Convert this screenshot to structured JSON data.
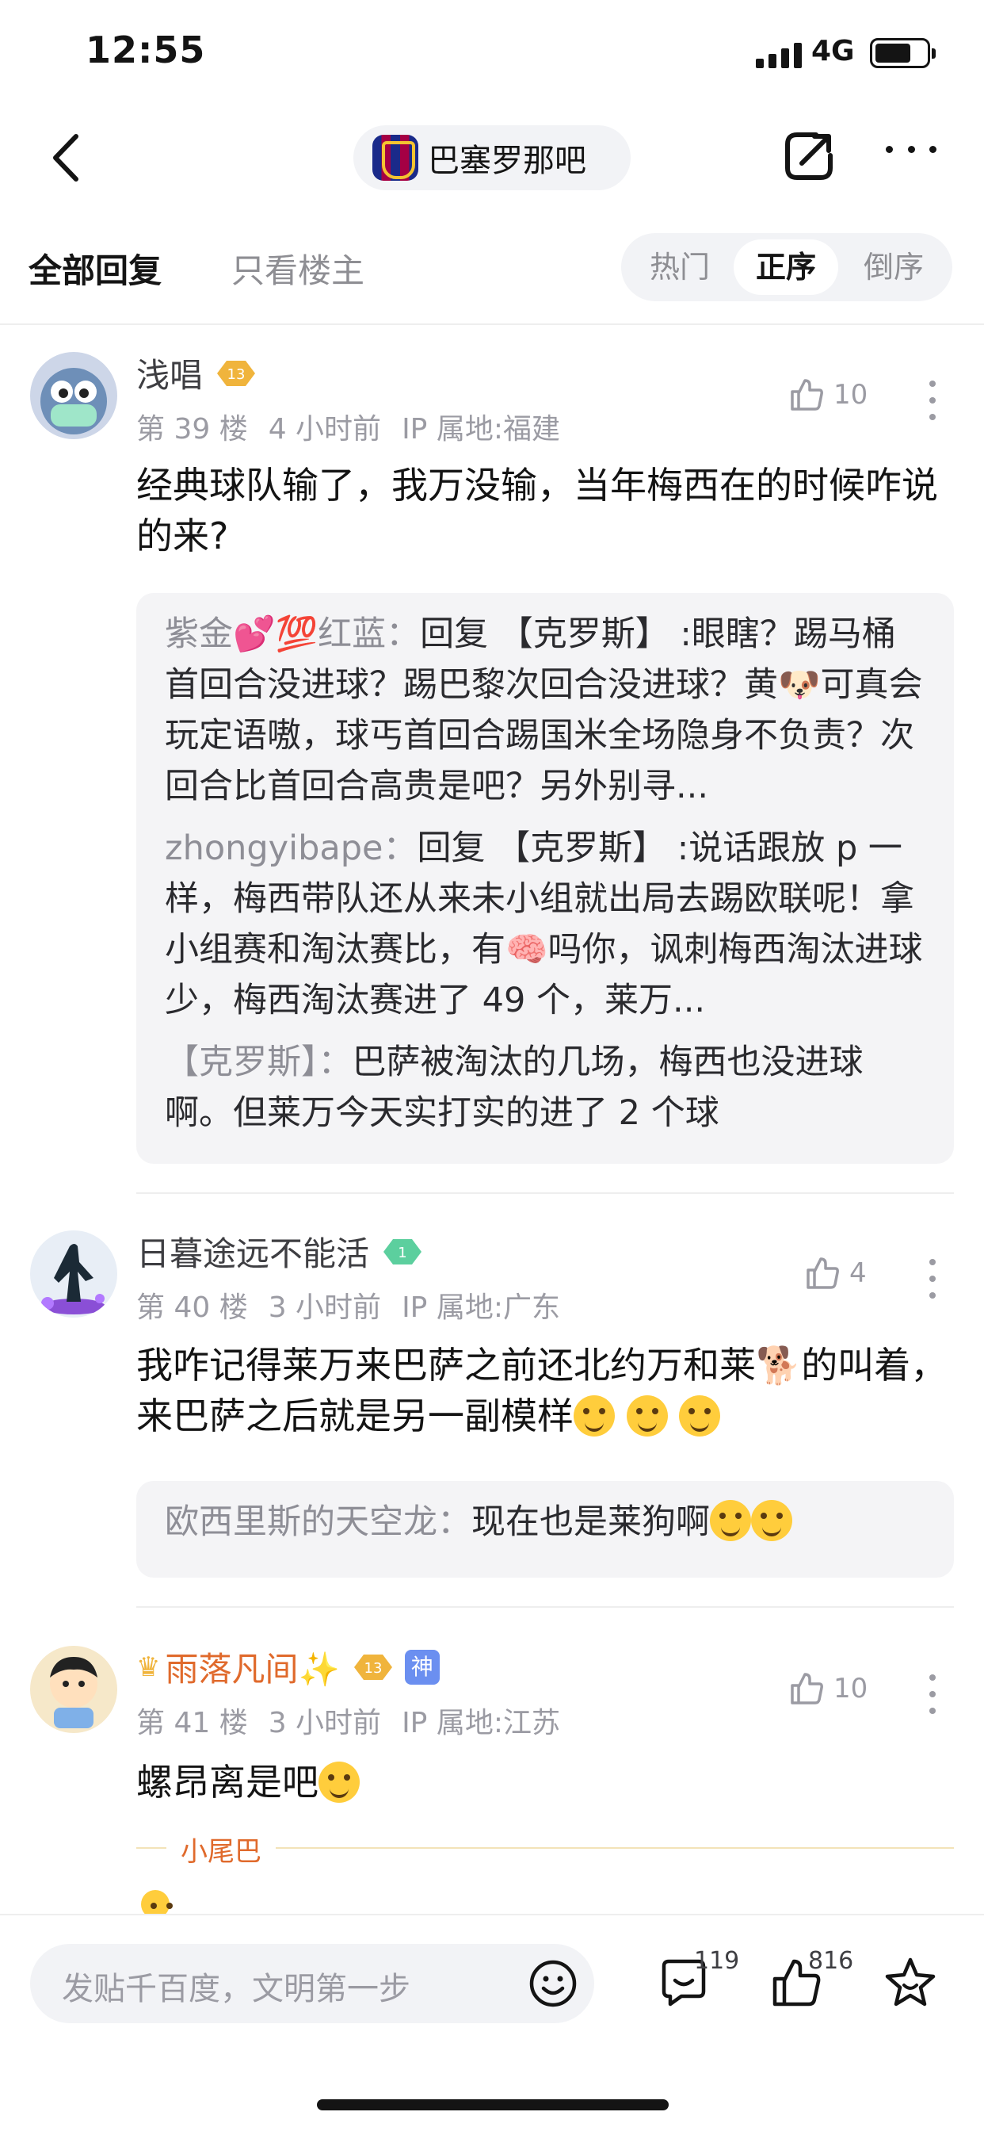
{
  "status_bar": {
    "time": "12:55",
    "network": "4G"
  },
  "nav": {
    "forum_name": "巴塞罗那吧"
  },
  "tabs": {
    "all": "全部回复",
    "op_only": "只看楼主"
  },
  "sort": {
    "hot": "热门",
    "asc": "正序",
    "desc": "倒序",
    "active": "正序"
  },
  "posts": [
    {
      "username": "浅唱",
      "level": "13",
      "floor": "第 39 楼",
      "time": "4 小时前",
      "ip": "IP 属地:福建",
      "likes": "10",
      "content": "经典球队输了，我万没输，当年梅西在的时候咋说的来?",
      "replies": [
        {
          "author": "紫金💕💯红蓝",
          "text": "回复 【克罗斯】 :眼瞎？踢马桶首回合没进球？踢巴黎次回合没进球？黄🐶可真会玩定语嗷，球丐首回合踢国米全场隐身不负责？次回合比首回合高贵是吧？另外别寻..."
        },
        {
          "author": "zhongyibape",
          "text": "回复 【克罗斯】 :说话跟放 p 一样，梅西带队还从来未小组就出局去踢欧联呢！拿小组赛和淘汰赛比，有🧠吗你，讽刺梅西淘汰进球少，梅西淘汰赛进了 49 个，莱万..."
        },
        {
          "author": "【克罗斯】",
          "text": "巴萨被淘汰的几场，梅西也没进球啊。但莱万今天实打实的进了 2 个球"
        }
      ]
    },
    {
      "username": "日暮途远不能活",
      "level": "1",
      "floor": "第 40 楼",
      "time": "3 小时前",
      "ip": "IP 属地:广东",
      "likes": "4",
      "content": "我咋记得莱万来巴萨之前还北约万和莱🐕的叫着，来巴萨之后就是另一副模样",
      "replies": [
        {
          "author": "欧西里斯的天空龙",
          "text": "现在也是莱狗啊"
        }
      ]
    },
    {
      "username": "雨落凡间✨",
      "level": "13",
      "god_badge": "神",
      "floor": "第 41 楼",
      "time": "3 小时前",
      "ip": "IP 属地:江苏",
      "likes": "10",
      "content": "螺昂离是吧",
      "tail_label": "小尾巴"
    }
  ],
  "bottom_bar": {
    "input_placeholder": "发贴千百度，文明第一步",
    "comment_count": "119",
    "like_count": "816"
  },
  "colors": {
    "accent_orange": "#e06a2c",
    "level_gold": "#f0b43c",
    "level_green": "#5ccf9e",
    "muted_text": "#9b9ba3",
    "reply_bg": "#f4f4f6"
  }
}
